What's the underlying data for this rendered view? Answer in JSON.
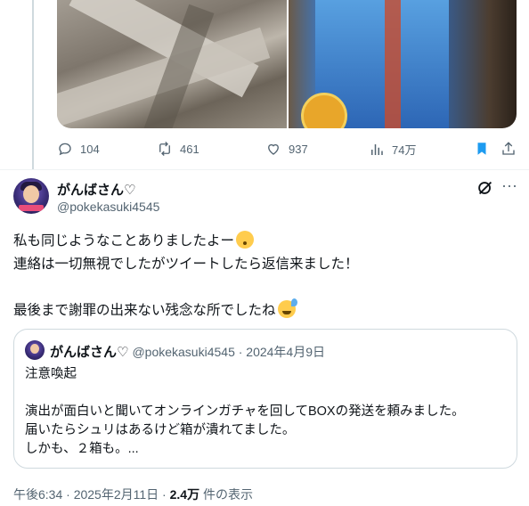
{
  "previous_tweet": {
    "media": [
      {
        "icon": "photo-cardboard-packaging"
      },
      {
        "icon": "photo-blue-box"
      }
    ],
    "actions": {
      "replies": "104",
      "retweets": "461",
      "likes": "937",
      "views": "74万"
    }
  },
  "tweet": {
    "display_name": "がんばさん♡",
    "handle": "@pokekasuki4545",
    "lines": [
      "私も同じようなことありましたよー",
      "連絡は一切無視でしたがツイートしたら返信来ました！",
      "",
      "最後まで謝罪の出来ない残念な所でしたね"
    ],
    "timestamp": "午後6:34 · 2025年2月11日",
    "views_count": "2.4万",
    "views_label": "件の表示"
  },
  "quote": {
    "display_name": "がんばさん♡",
    "handle_date": "@pokekasuki4545 · 2024年4月9日",
    "lines": [
      "注意喚起",
      "",
      "演出が面白いと聞いてオンラインガチャを回してBOXの発送を頼みました。",
      "届いたらシュリはあるけど箱が潰れてました。",
      "しかも、２箱も。..."
    ]
  },
  "colors": {
    "text": "#0f1419",
    "secondary": "#536471",
    "accent": "#1d9bf0",
    "border": "#cfd9de"
  }
}
